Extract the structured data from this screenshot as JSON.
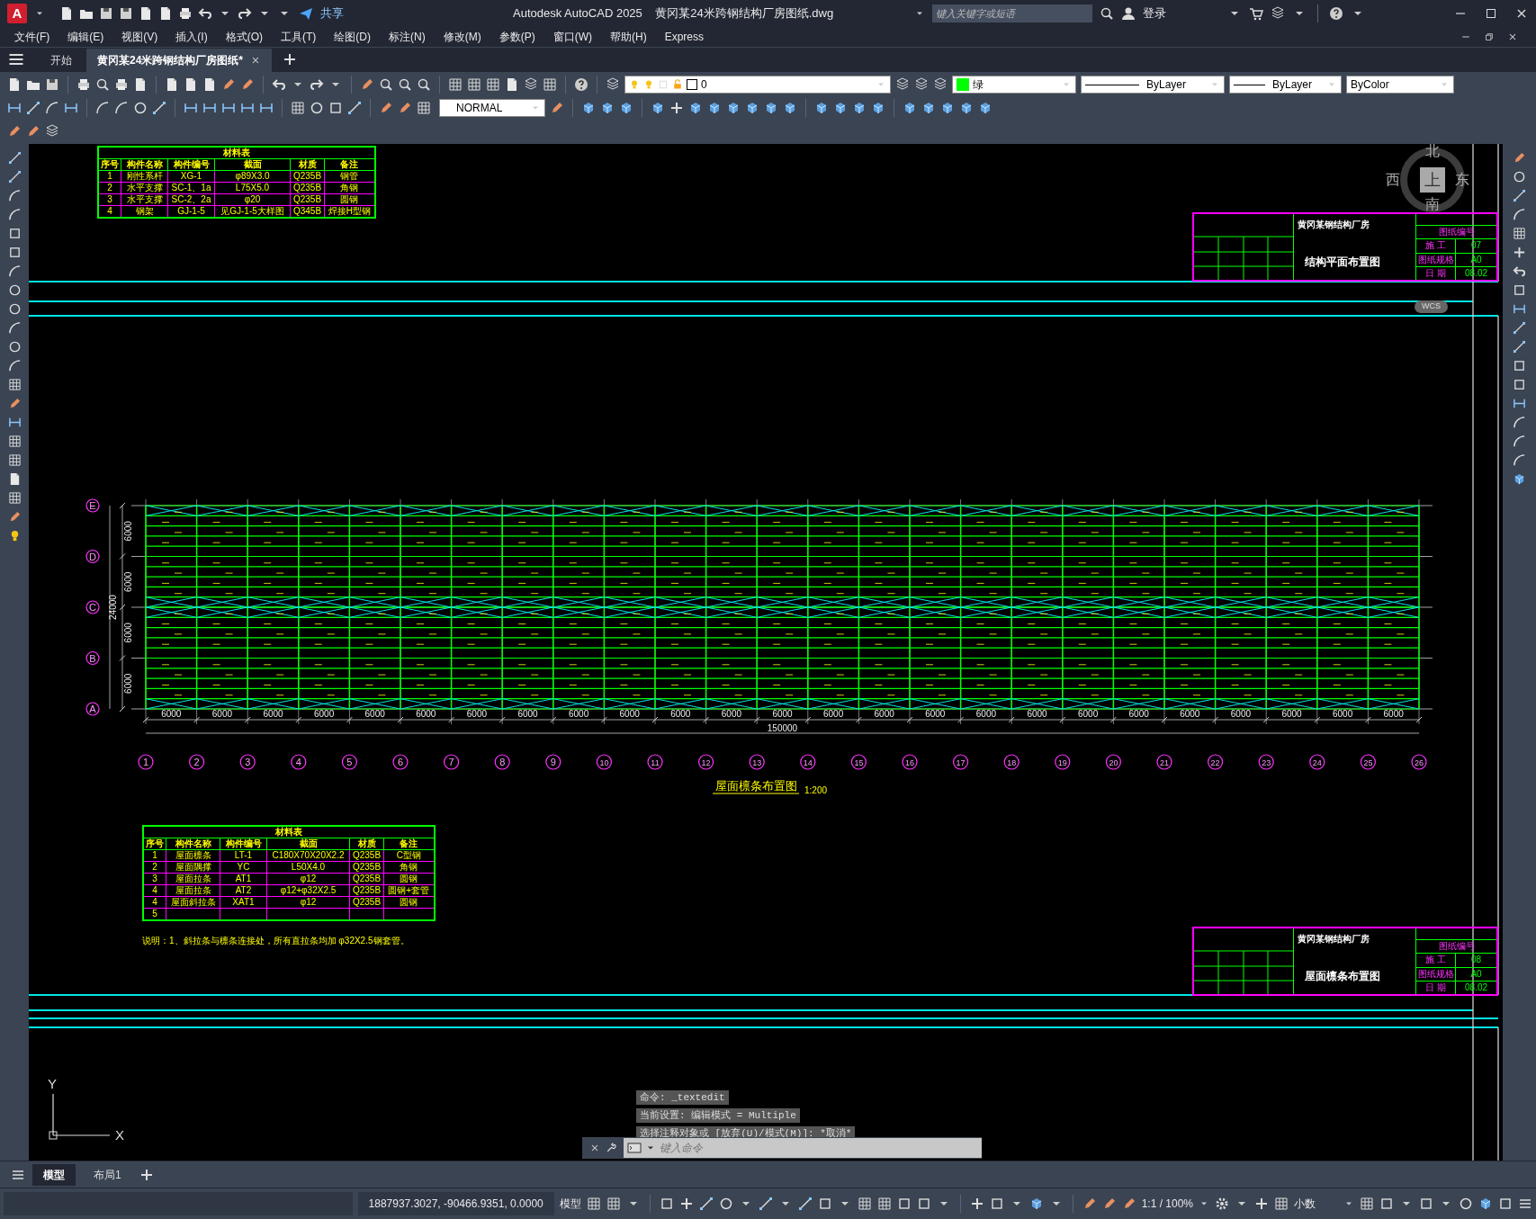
{
  "title_bar": {
    "logo": "A",
    "share": "共享",
    "title": "Autodesk AutoCAD 2025    黄冈某24米跨钢结构厂房图纸.dwg",
    "search": {
      "placeholder": "键入关键字或短语"
    },
    "sign_in": "登录"
  },
  "menu_bar": [
    "文件(F)",
    "编辑(E)",
    "视图(V)",
    "插入(I)",
    "格式(O)",
    "工具(T)",
    "绘图(D)",
    "标注(N)",
    "修改(M)",
    "参数(P)",
    "窗口(W)",
    "帮助(H)",
    "Express"
  ],
  "file_tabs": [
    {
      "label": "开始",
      "selected": false
    },
    {
      "label": "黄冈某24米跨钢结构厂房图纸*",
      "selected": true
    }
  ],
  "toolbar": {
    "layer": "0",
    "color": {
      "label": "绿",
      "color": "#00ff00"
    },
    "linetype": "ByLayer",
    "lineweight": "ByLayer",
    "plot_style": "ByColor",
    "text_style": "NORMAL"
  },
  "drawing": {
    "material_tables": [
      {
        "title": "材料表",
        "columns": [
          "序号",
          "构件名称",
          "构件编号",
          "截面",
          "材质",
          "备注"
        ],
        "rows": [
          [
            "1",
            "刚性系杆",
            "XG-1",
            "φ89X3.0",
            "Q235B",
            "钢管"
          ],
          [
            "2",
            "水平支撑",
            "SC-1、1a",
            "L75X5.0",
            "Q235B",
            "角钢"
          ],
          [
            "3",
            "水平支撑",
            "SC-2、2a",
            "φ20",
            "Q235B",
            "圆钢"
          ],
          [
            "4",
            "钢架",
            "GJ-1-5",
            "见GJ-1-5大样图",
            "Q345B",
            "焊接H型钢"
          ]
        ]
      },
      {
        "title": "材料表",
        "columns": [
          "序号",
          "构件名称",
          "构件编号",
          "截面",
          "材质",
          "备注"
        ],
        "rows": [
          [
            "1",
            "屋面檩条",
            "LT-1",
            "C180X70X20X2.2",
            "Q235B",
            "C型钢"
          ],
          [
            "2",
            "屋面隅撑",
            "YC",
            "L50X4.0",
            "Q235B",
            "角钢"
          ],
          [
            "3",
            "屋面拉条",
            "AT1",
            "φ12",
            "Q235B",
            "圆钢"
          ],
          [
            "4",
            "屋面拉条",
            "AT2",
            "φ12+φ32X2.5",
            "Q235B",
            "圆钢+套管"
          ],
          [
            "4",
            "屋面斜拉条",
            "XAT1",
            "φ12",
            "Q235B",
            "圆钢"
          ],
          [
            "5",
            null,
            null,
            null,
            null,
            null
          ]
        ]
      }
    ],
    "note": "说明：1、斜拉条与檩条连接处，所有直拉条均加 φ32X2.5钢套管。",
    "row_axes": [
      "E",
      "D",
      "C",
      "B",
      "A"
    ],
    "column_axes": [
      "1",
      "2",
      "3",
      "4",
      "5",
      "6",
      "7",
      "8",
      "9",
      "10",
      "11",
      "12",
      "13",
      "14",
      "15",
      "16",
      "17",
      "18",
      "19",
      "20",
      "21",
      "22",
      "23",
      "24",
      "25",
      "26"
    ],
    "bay_dimensions": [
      "6000",
      "6000",
      "6000",
      "6000",
      "6000",
      "6000",
      "6000",
      "6000",
      "6000",
      "6000",
      "6000",
      "6000",
      "6000",
      "6000",
      "6000",
      "6000",
      "6000",
      "6000",
      "6000",
      "6000",
      "6000",
      "6000",
      "6000",
      "6000",
      "6000"
    ],
    "total_length": "150000",
    "span_dimensions": [
      "6000",
      "6000",
      "6000",
      "6000"
    ],
    "total_span": "24000",
    "caption": "屋面檩条布置图",
    "caption_scale": "1:200",
    "title_blocks": [
      {
        "project": "黄冈某钢结构厂房",
        "title": "结构平面布置图",
        "number_label": "图纸编号",
        "rows": [
          {
            "label": "施 工",
            "value": "07"
          },
          {
            "label": "图纸规格",
            "value": "A0"
          },
          {
            "label": "日 期",
            "value": "08.02"
          }
        ]
      },
      {
        "project": "黄冈某钢结构厂房",
        "title": "屋面檩条布置图",
        "number_label": "图纸编号",
        "rows": [
          {
            "label": "施 工",
            "value": "08"
          },
          {
            "label": "图纸规格",
            "value": "A0"
          },
          {
            "label": "日 期",
            "value": "08.02"
          }
        ]
      }
    ],
    "view_cube": {
      "north": "北",
      "east": "东",
      "south": "南",
      "west": "西",
      "face": "上",
      "wcs": "WCS"
    },
    "ucs": {
      "y": "Y",
      "x": "X"
    }
  },
  "command_history": [
    "命令: _textedit",
    "当前设置: 编辑模式 = Multiple",
    "选择注释对象或 [放弃(U)/模式(M)]: *取消*"
  ],
  "command_line": {
    "placeholder": "键入命令"
  },
  "layout_tabs": [
    {
      "label": "模型",
      "selected": true
    },
    {
      "label": "布局1",
      "selected": false
    }
  ],
  "status_bar": {
    "coordinates": "1887937.3027, -90466.9351, 0.0000",
    "space": "模型",
    "scale": "1:1 / 100%",
    "units": "小数"
  }
}
